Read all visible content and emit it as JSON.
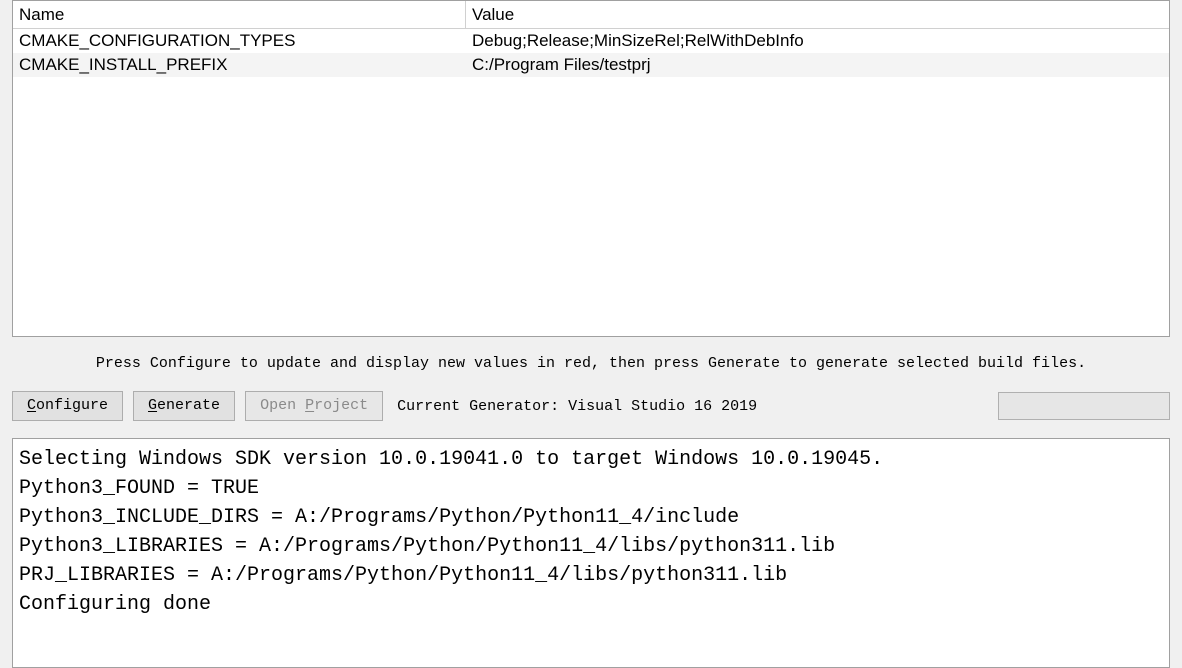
{
  "vars": {
    "header_name": "Name",
    "header_value": "Value",
    "rows": [
      {
        "name": "CMAKE_CONFIGURATION_TYPES",
        "value": "Debug;Release;MinSizeRel;RelWithDebInfo"
      },
      {
        "name": "CMAKE_INSTALL_PREFIX",
        "value": "C:/Program Files/testprj"
      }
    ]
  },
  "hint": "Press Configure to update and display new values in red, then press Generate to generate selected build files.",
  "toolbar": {
    "configure_html": "<span class=\"ul\">C</span>onfigure",
    "generate_html": "<span class=\"ul\">G</span>enerate",
    "open_project_html": "Open <span class=\"ul\">P</span>roject",
    "generator_label": "Current Generator: Visual Studio 16 2019"
  },
  "output_lines": [
    "Selecting Windows SDK version 10.0.19041.0 to target Windows 10.0.19045.",
    "Python3_FOUND = TRUE",
    "Python3_INCLUDE_DIRS = A:/Programs/Python/Python11_4/include",
    "Python3_LIBRARIES = A:/Programs/Python/Python11_4/libs/python311.lib",
    "PRJ_LIBRARIES = A:/Programs/Python/Python11_4/libs/python311.lib",
    "Configuring done"
  ]
}
